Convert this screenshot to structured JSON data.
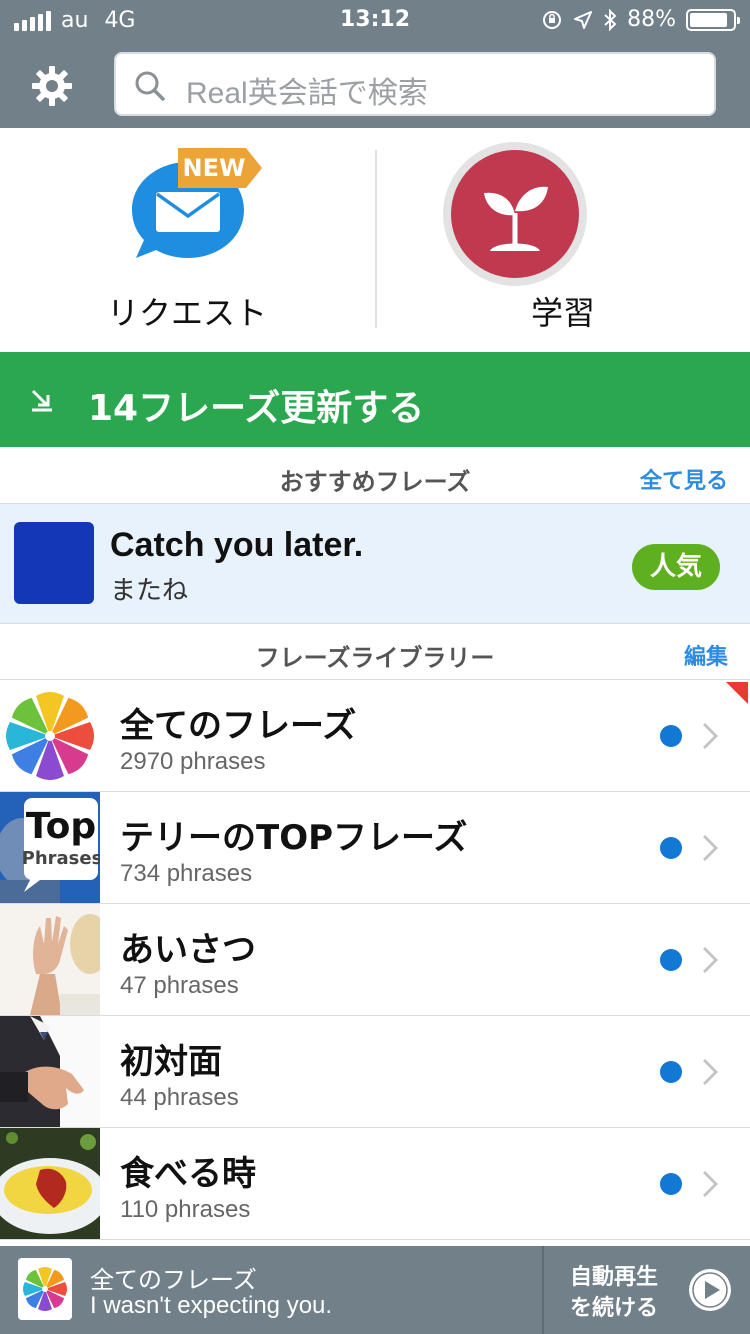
{
  "status_bar": {
    "carrier": "au",
    "network": "4G",
    "time": "13:12",
    "battery": "88%",
    "battery_level": 0.88
  },
  "header": {
    "search_placeholder": "Real英会話で検索"
  },
  "actions": {
    "request_label": "リクエスト",
    "new_badge": "NEW",
    "study_label": "学習"
  },
  "update_banner": {
    "label": "14フレーズ更新する"
  },
  "recommended": {
    "title": "おすすめフレーズ",
    "see_all": "全て見る",
    "phrase_en": "Catch you later.",
    "phrase_ja": "またね",
    "badge": "人気"
  },
  "library": {
    "title": "フレーズライブラリー",
    "edit": "編集",
    "items": [
      {
        "title": "全てのフレーズ",
        "count": "2970 phrases"
      },
      {
        "title": "テリーのTOPフレーズ",
        "count": "734 phrases",
        "thumb_text_top": "Top",
        "thumb_text_bottom": "Phrases"
      },
      {
        "title": "あいさつ",
        "count": "47 phrases"
      },
      {
        "title": "初対面",
        "count": "44 phrases"
      },
      {
        "title": "食べる時",
        "count": "110 phrases"
      }
    ]
  },
  "player": {
    "title": "全てのフレーズ",
    "phrase": "I wasn't expecting you.",
    "autoplay_line1": "自動再生",
    "autoplay_line2": "を続ける"
  },
  "colors": {
    "header": "#718089",
    "update_green": "#2ba84f",
    "link_blue": "#2f8be0",
    "dot_blue": "#1377d4",
    "popular_green": "#5fb021",
    "study_red": "#c0394f"
  }
}
